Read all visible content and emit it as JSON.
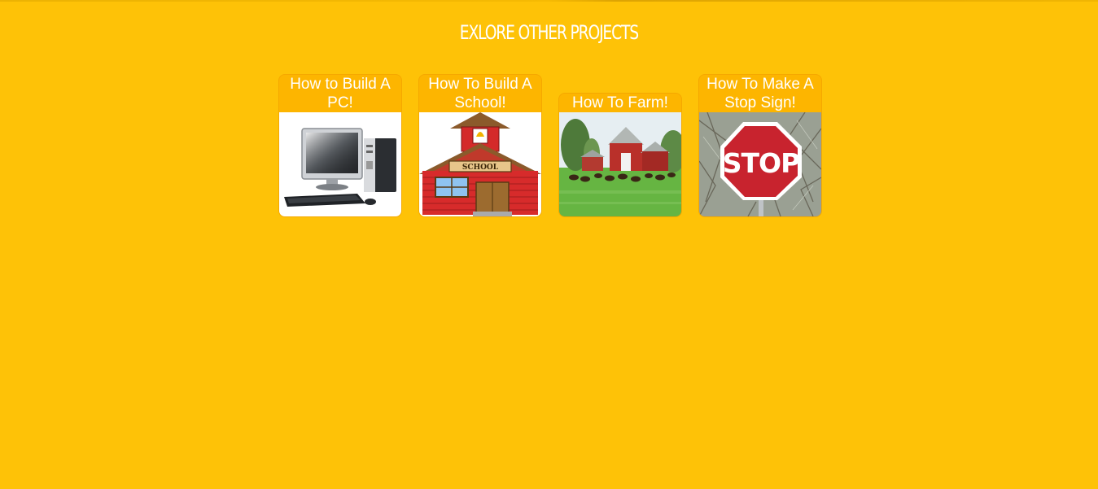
{
  "page": {
    "heading": "Exlore Other Projects"
  },
  "projects": [
    {
      "title": "How to Build A PC!",
      "thumbnail": "desktop-computer-icon"
    },
    {
      "title": "How To Build A School!",
      "thumbnail": "schoolhouse-icon"
    },
    {
      "title": "How To Farm!",
      "thumbnail": "farm-barn-icon"
    },
    {
      "title": "How To Make A Stop Sign!",
      "thumbnail": "stop-sign-icon"
    }
  ],
  "images": {
    "school_sign_text": "SCHOOL",
    "stop_sign_text": "STOP"
  },
  "colors": {
    "background": "#fec207",
    "card_header": "#fdb500",
    "text": "#ffffff"
  }
}
